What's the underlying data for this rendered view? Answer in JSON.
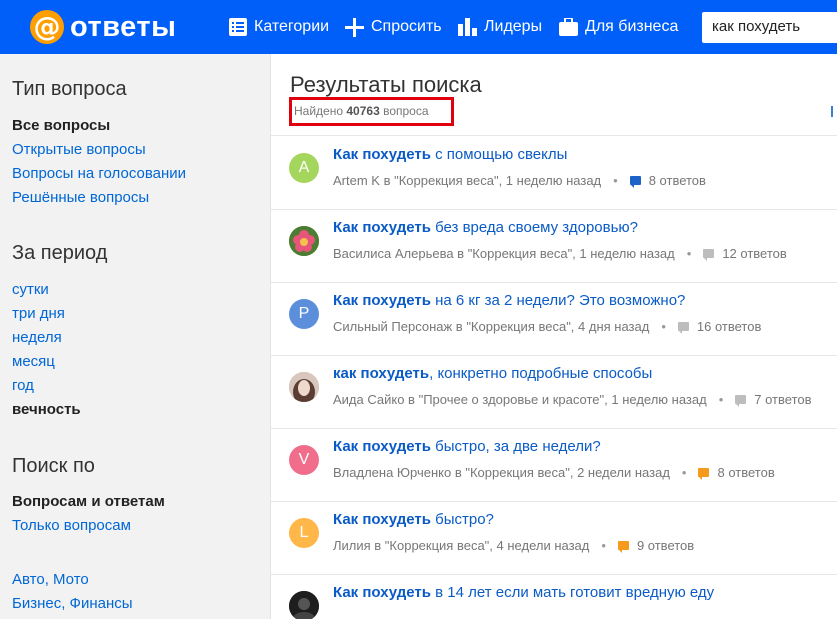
{
  "header": {
    "logo_text": "ответы",
    "nav": {
      "categories": "Категории",
      "ask": "Спросить",
      "leaders": "Лидеры",
      "business": "Для бизнеса"
    },
    "search_value": "как похудеть"
  },
  "sidebar": {
    "type_heading": "Тип вопроса",
    "type_items": [
      "Все вопросы",
      "Открытые вопросы",
      "Вопросы на голосовании",
      "Решённые вопросы"
    ],
    "period_heading": "За период",
    "period_items": [
      "сутки",
      "три дня",
      "неделя",
      "месяц",
      "год",
      "вечность"
    ],
    "search_heading": "Поиск по",
    "search_items": [
      "Вопросам и ответам",
      "Только вопросам"
    ],
    "categories": [
      "Авто, Мото",
      "Бизнес, Финансы"
    ]
  },
  "main": {
    "title": "Результаты поиска",
    "found_prefix": "Найдено",
    "found_count": "40763",
    "found_suffix": "вопроса",
    "results": [
      {
        "avatar": "A",
        "avatar_color": "#a4d65e",
        "keyword": "Как похудеть",
        "rest": " с помощью свеклы",
        "meta": "Artem K в \"Коррекция веса\", 1 неделю назад",
        "answers": "8 ответов",
        "bubble_color": "#1d62c9"
      },
      {
        "avatar": "",
        "avatar_color": "#5a8a3a",
        "keyword": "Как похудеть",
        "rest": " без вреда своему здоровью?",
        "meta": "Василиса Алерьева в \"Коррекция веса\", 1 неделю назад",
        "answers": "12 ответов",
        "bubble_color": "#bdbdbd"
      },
      {
        "avatar": "P",
        "avatar_color": "#5b8fdc",
        "keyword": "Как похудеть",
        "rest": " на 6 кг за 2 недели? Это возможно?",
        "meta": "Сильный Персонаж в \"Коррекция веса\", 4 дня назад",
        "answers": "16 ответов",
        "bubble_color": "#bdbdbd"
      },
      {
        "avatar": "",
        "avatar_color": "#b89a8c",
        "keyword": "как похудеть",
        "rest": ", конкретно подробные способы",
        "meta": "Аида Сайко в \"Прочее о здоровье и красоте\", 1 неделю назад",
        "answers": "7 ответов",
        "bubble_color": "#bdbdbd"
      },
      {
        "avatar": "V",
        "avatar_color": "#f06e8c",
        "keyword": "Как похудеть",
        "rest": " быстро, за две недели?",
        "meta": "Владлена Юрченко в \"Коррекция веса\", 2 недели назад",
        "answers": "8 ответов",
        "bubble_color": "#f59a1a"
      },
      {
        "avatar": "L",
        "avatar_color": "#ffb74a",
        "keyword": "Как похудеть",
        "rest": " быстро?",
        "meta": "Лилия в \"Коррекция веса\", 4 недели назад",
        "answers": "9 ответов",
        "bubble_color": "#f59a1a"
      },
      {
        "avatar": "",
        "avatar_color": "#2a2a2a",
        "keyword": "Как похудеть",
        "rest": " в 14 лет если мать готовит вредную еду",
        "meta": "",
        "answers": "",
        "bubble_color": "#f59a1a"
      }
    ]
  }
}
